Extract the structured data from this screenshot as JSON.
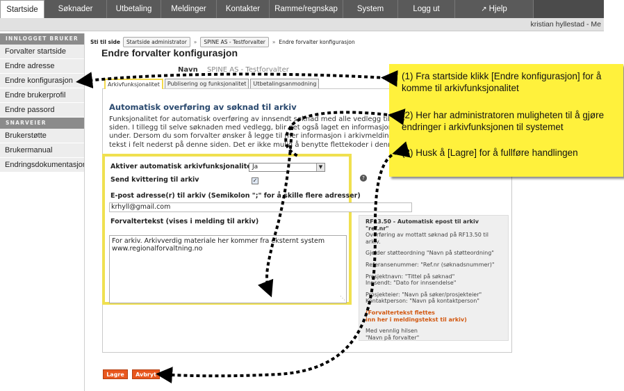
{
  "topnav": {
    "tabs": [
      {
        "label": "Startside",
        "active": true
      },
      {
        "label": "Søknader"
      },
      {
        "label": "Utbetaling"
      },
      {
        "label": "Meldinger"
      },
      {
        "label": "Kontakter"
      },
      {
        "label": "Ramme/regnskap"
      },
      {
        "label": "System"
      },
      {
        "label": "Logg ut"
      },
      {
        "label": "Hjelp",
        "icon": "external-link-icon"
      }
    ],
    "user": "kristian hyllestad - Me"
  },
  "sidebar": {
    "section1": "INNLOGGET BRUKER",
    "items1": [
      "Forvalter startside",
      "Endre adresse",
      "Endre konfigurasjon",
      "Endre brukerprofil",
      "Endre passord"
    ],
    "section2": "SNARVEIER",
    "items2": [
      "Brukerstøtte",
      "Brukermanual",
      "Endringsdokumentasjon"
    ]
  },
  "breadcrumb": {
    "lead": "Sti til side",
    "items": [
      "Startside administrator",
      "SPINE AS - Testforvalter",
      "Endre forvalter konfigurasjon"
    ]
  },
  "page": {
    "title": "Endre forvalter konfigurasjon",
    "name_label": "Navn",
    "name_value": "SPINE AS - Testforvalter"
  },
  "tabs": [
    "Arkivfunksjonalitet",
    "Publisering og funksjonalitet",
    "Utbetalingsanmodning"
  ],
  "section": {
    "title": "Automatisk overføring av søknad til arkiv",
    "description": "Funksjonalitet for automatisk overføring av innsendt søknad med alle vedlegg til arkiv siden. I tillegg til selve søknaden med vedlegg, blir det også laget en informasjonsme under. Dersom du som forvalter ønsker å legge til mer informasjon i arkivmelding, kan tekst i felt nederst på denne siden. Det er ikke mulig å benytte flettekoder i denne te"
  },
  "form": {
    "auto_label": "Aktiver automatisk arkivfunksjonalitet",
    "auto_value": "Ja",
    "receipt_label": "Send kvittering til arkiv",
    "receipt_checked": true,
    "email_label": "E-post adresse(r) til arkiv (Semikolon \";\" for å skille flere adresser)",
    "email_value": "krhyll@gmail.com",
    "text_label": "Forvaltertekst (vises i melding til arkiv)",
    "text_line1": "For arkiv. Arkivverdig materiale her kommer fra eksternt system",
    "text_line2": "www.regionalforvaltning.no"
  },
  "info": {
    "title": "RF13.50 - Automatisk epost til arkiv \"ref.nr\"",
    "line1": "Overføring av mottatt søknad på RF13.50 til arkiv.",
    "line2": "Gjelder støtteordning \"Navn på støtteordning\"",
    "line3": "Referansenummer: \"Ref.nr (søknadsnummer)\"",
    "line4": "Prosjektnavn: \"Tittel på søknad\"",
    "line5": "Innsendt: \"Dato for innsendelse\"",
    "line6": "Prosjekteier: \"Navn på søker/prosjekteier\"",
    "line7": "Kontaktperson: \"Navn på kontaktperson\"",
    "hl1": "(Forvaltertekst flettes",
    "hl2": "inn her i meldingstekst til arkiv)",
    "line8": "Med vennlig hilsen",
    "line9": "\"Navn på forvalter\""
  },
  "buttons": {
    "save": "Lagre",
    "cancel": "Avbryt"
  },
  "callouts": [
    "(1) Fra startside klikk [Endre konfigurasjon] for å komme til arkivfunksjonalitet",
    "(2) Her har administratoren muligheten til å gjøre endringer i arkivfunksjonen til systemet",
    "(3) Husk å [Lagre] for å fullføre handlingen"
  ],
  "colors": {
    "accent_orange": "#e8571e",
    "highlight_yellow": "#f0e050",
    "callout_yellow": "#fff13c",
    "nav_dark": "#4b4b4b"
  }
}
